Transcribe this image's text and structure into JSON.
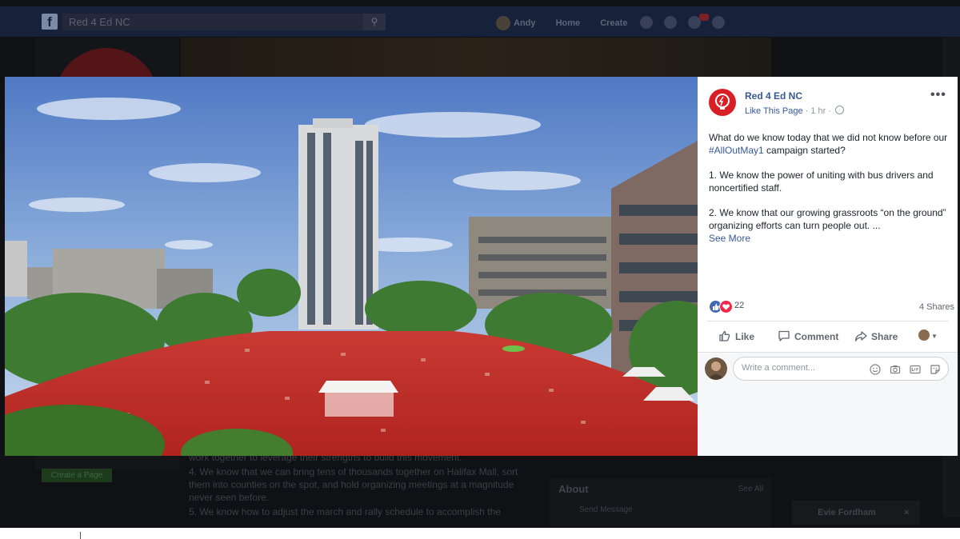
{
  "background": {
    "search_value": "Red 4 Ed NC",
    "nav": {
      "user": "Andy",
      "home": "Home",
      "create": "Create"
    },
    "notification_count": "14",
    "create_page_button": "Create a Page",
    "post_text": [
      "work together to leverage their strengths to build this movement.",
      "4. We know that we can bring tens of thousands together on Halifax Mall, sort them into counties on the spot, and hold organizing meetings at a magnitude never seen before.",
      "5. We know how to adjust the march and rally schedule to accomplish the"
    ],
    "about_title": "About",
    "about_see_all": "See All",
    "about_send_message": "Send Message",
    "chat_contact": "Evie Fordham"
  },
  "post": {
    "page_name": "Red 4 Ed NC",
    "like_page": "Like This Page",
    "separator": " · ",
    "time": "1 hr",
    "more": "•••",
    "paragraphs": {
      "p1_before": "What do we know today that we did not know before our ",
      "p1_hashtag": "#AllOutMay1",
      "p1_after": " campaign started?",
      "p2": "1. We know the power of uniting with bus drivers and noncertified staff.",
      "p3": "2. We know that our growing grassroots “on the ground” organizing efforts can turn people out. ..."
    },
    "see_more": "See More",
    "reaction_count": "22",
    "shares": "4 Shares",
    "actions": {
      "like": "Like",
      "comment": "Comment",
      "share": "Share"
    },
    "comment_placeholder": "Write a comment...",
    "icons": [
      "like-reaction-icon",
      "love-reaction-icon",
      "thumbs-up-icon",
      "comment-bubble-icon",
      "share-arrow-icon",
      "emoji-icon",
      "camera-icon",
      "gif-icon",
      "sticker-icon",
      "globe-icon"
    ]
  },
  "colors": {
    "link": "#365899",
    "like_blue": "#4267b2",
    "love_red": "#f0284a",
    "brand_red": "#d91f26",
    "topbar": "#17223a"
  }
}
